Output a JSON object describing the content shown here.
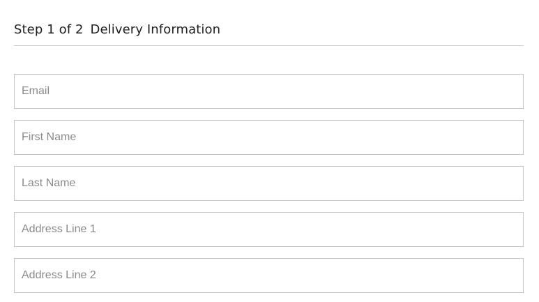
{
  "header": {
    "step": "Step 1 of 2",
    "title": "Delivery Information"
  },
  "form": {
    "fields": [
      {
        "placeholder": "Email",
        "value": ""
      },
      {
        "placeholder": "First Name",
        "value": ""
      },
      {
        "placeholder": "Last Name",
        "value": ""
      },
      {
        "placeholder": "Address Line 1",
        "value": ""
      },
      {
        "placeholder": "Address Line 2",
        "value": ""
      }
    ]
  },
  "colors": {
    "border": "#c6c6c6",
    "divider": "#c8c8c8",
    "placeholder": "#8a8a8a",
    "heading": "#1f1f1f"
  }
}
